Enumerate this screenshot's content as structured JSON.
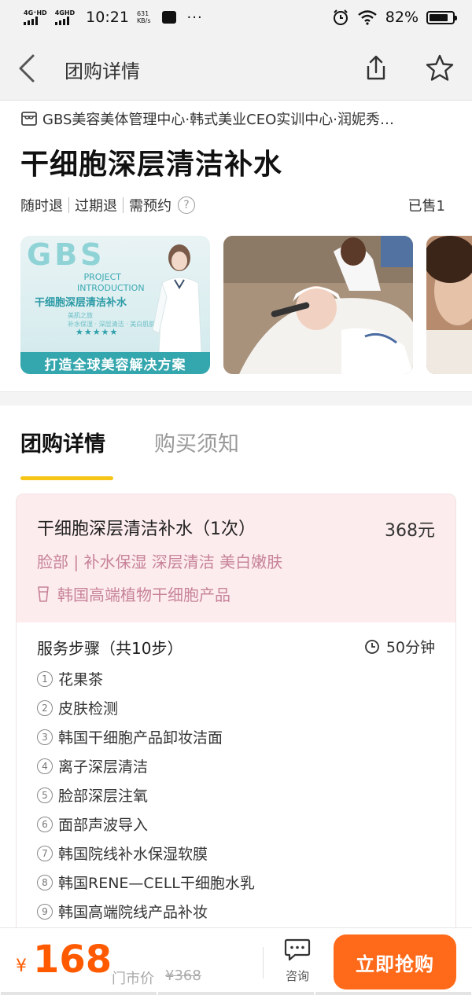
{
  "statusbar": {
    "sim1": "4G⁺HD",
    "sim2": "4GHD",
    "time": "10:21",
    "speed_value": "631",
    "speed_unit": "KB/s",
    "dots": "···",
    "battery": "82%",
    "battery_level": 0.82
  },
  "nav": {
    "title": "团购详情"
  },
  "shop": {
    "name": "GBS美容美体管理中心·韩式美业CEO实训中心·润妮秀…"
  },
  "deal": {
    "title": "干细胞深层清洁补水",
    "tags": [
      "随时退",
      "过期退",
      "需预约"
    ],
    "help": "?",
    "sold": "已售1"
  },
  "gallery": {
    "img1_logo": "GBS",
    "img1_project": "PROJECT",
    "img1_introduction": "INTRODUCTION",
    "img1_heading": "干细胞深层清洁补水",
    "img1_sub": "美肌之旅",
    "img1_sub2": "补水保湿 · 深层清洁 · 美白肌肤",
    "img1_stars": "★★★★★",
    "img1_banner": "打造全球美容解决方案"
  },
  "tabs": {
    "details": "团购详情",
    "notice": "购买须知"
  },
  "card": {
    "title": "干细胞深层清洁补水（1次）",
    "price": "368元",
    "tags": "脸部 | 补水保湿 深层清洁 美白嫩肤",
    "product": "韩国高端植物干细胞产品",
    "steps_title": "服务步骤（共10步）",
    "duration": "50分钟",
    "steps": [
      {
        "num": "1",
        "text": "花果茶"
      },
      {
        "num": "2",
        "text": "皮肤检测"
      },
      {
        "num": "3",
        "text": "韩国干细胞产品卸妆洁面"
      },
      {
        "num": "4",
        "text": "离子深层清洁"
      },
      {
        "num": "5",
        "text": "脸部深层注氧"
      },
      {
        "num": "6",
        "text": "面部声波导入"
      },
      {
        "num": "7",
        "text": "韩国院线补水保湿软膜"
      },
      {
        "num": "8",
        "text": "韩国RENE—CELL干细胞水乳"
      },
      {
        "num": "9",
        "text": "韩国高端院线产品补妆"
      }
    ]
  },
  "bottom": {
    "currency": "¥",
    "price": "168",
    "market_label": "门市价",
    "market_price": "¥368",
    "consult": "咨询",
    "buy": "立即抢购"
  },
  "colors": {
    "accent": "#ff6a1a",
    "price": "#ff5a00",
    "tab_underline": "#f5c518",
    "card_head_bg": "#fdeced",
    "tag_pink": "#c7839a"
  }
}
